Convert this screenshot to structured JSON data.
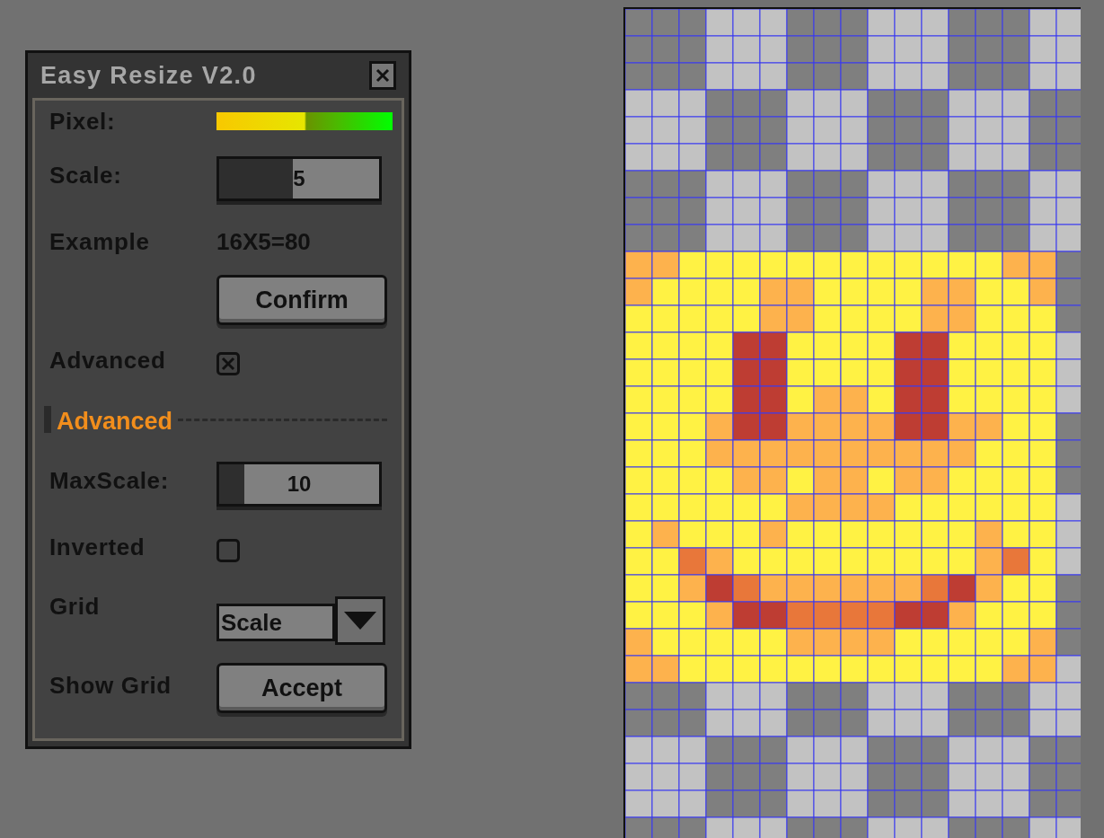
{
  "window": {
    "title": "Easy Resize V2.0"
  },
  "rows": [
    {
      "kind": "meter",
      "label": "Pixel:"
    },
    {
      "kind": "slider",
      "label": "Scale:",
      "value": "5",
      "level": 0.46
    },
    {
      "kind": "text",
      "label": "Example",
      "value": "16X5=80"
    },
    {
      "kind": "button",
      "button": "Confirm"
    },
    {
      "kind": "checkbox",
      "label": "Advanced",
      "checked": true
    },
    {
      "kind": "section",
      "label": "Advanced"
    },
    {
      "kind": "slider",
      "label": "MaxScale:",
      "value": "10",
      "level": 0.16
    },
    {
      "kind": "checkbox",
      "label": "Inverted",
      "checked": false
    },
    {
      "kind": "dropdown",
      "label": "Grid",
      "value": "Scale"
    },
    {
      "kind": "button",
      "label": "Show Grid",
      "button": "Accept"
    }
  ]
}
